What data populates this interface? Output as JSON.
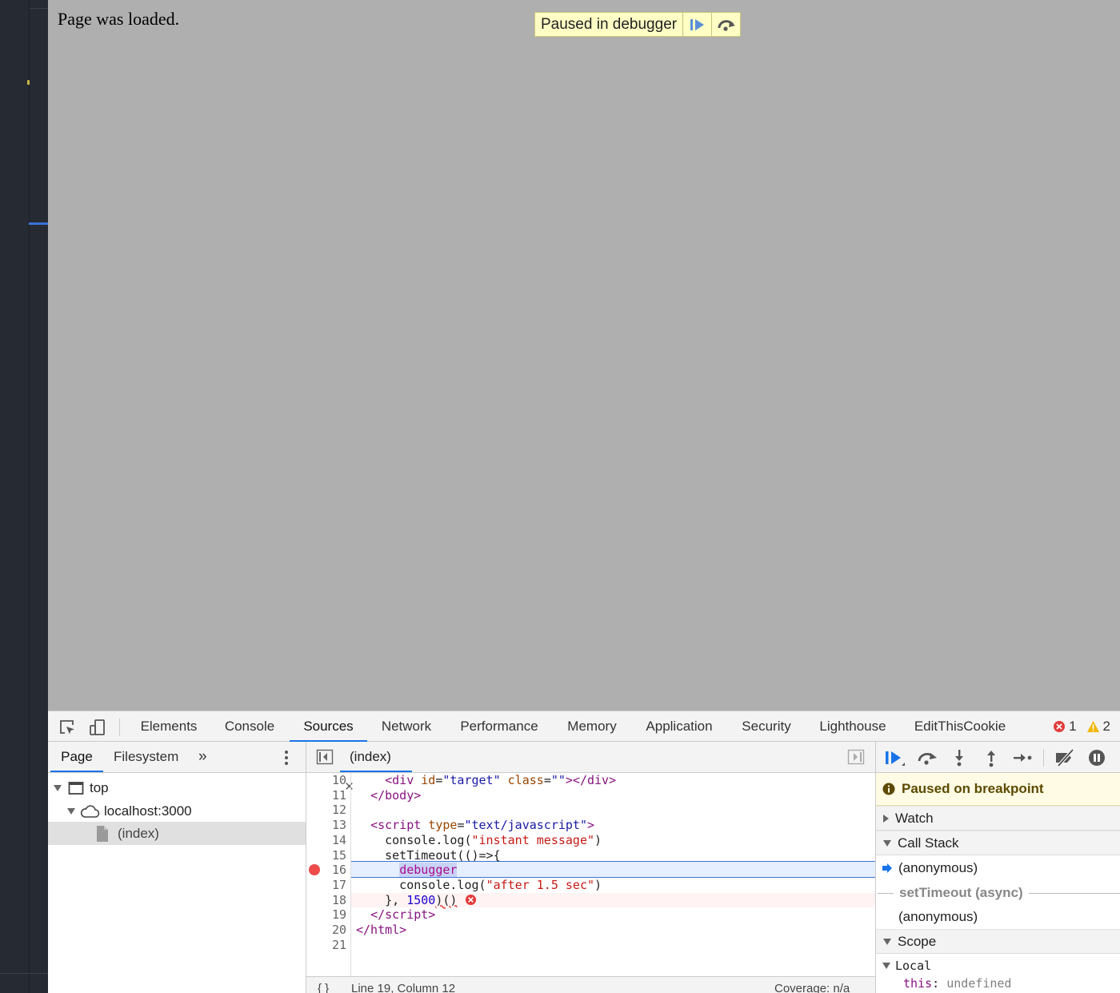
{
  "page": {
    "text": "Page was loaded.",
    "paused_banner": {
      "label": "Paused in debugger",
      "resume_icon": "resume-icon",
      "step_over_icon": "step-over-icon"
    }
  },
  "devtools": {
    "tabs": [
      "Elements",
      "Console",
      "Sources",
      "Network",
      "Performance",
      "Memory",
      "Application",
      "Security",
      "Lighthouse",
      "EditThisCookie"
    ],
    "active_tab": "Sources",
    "error_count": "1",
    "warning_count": "2",
    "navigator": {
      "tabs": [
        "Page",
        "Filesystem"
      ],
      "more": "»",
      "tree": {
        "top": "top",
        "origin": "localhost:3000",
        "file": "(index)"
      }
    },
    "editor": {
      "file_tab": "(index)",
      "close": "×",
      "line_numbers": [
        "10",
        "11",
        "12",
        "13",
        "14",
        "15",
        "16",
        "17",
        "18",
        "19",
        "20",
        "21"
      ],
      "status": {
        "format": "{ }",
        "position": "Line 19, Column 12",
        "coverage": "Coverage: n/a"
      }
    },
    "debugger": {
      "paused_message": "Paused on breakpoint",
      "watch": "Watch",
      "call_stack": "Call Stack",
      "frames": [
        "(anonymous)",
        "setTimeout (async)",
        "(anonymous)"
      ],
      "scope": "Scope",
      "local": "Local",
      "this_key": "this",
      "this_value": "undefined"
    }
  },
  "colors": {
    "accent": "#1a73e8",
    "breakpoint": "#ee4b4b",
    "paused_bg": "#ffffc5"
  }
}
